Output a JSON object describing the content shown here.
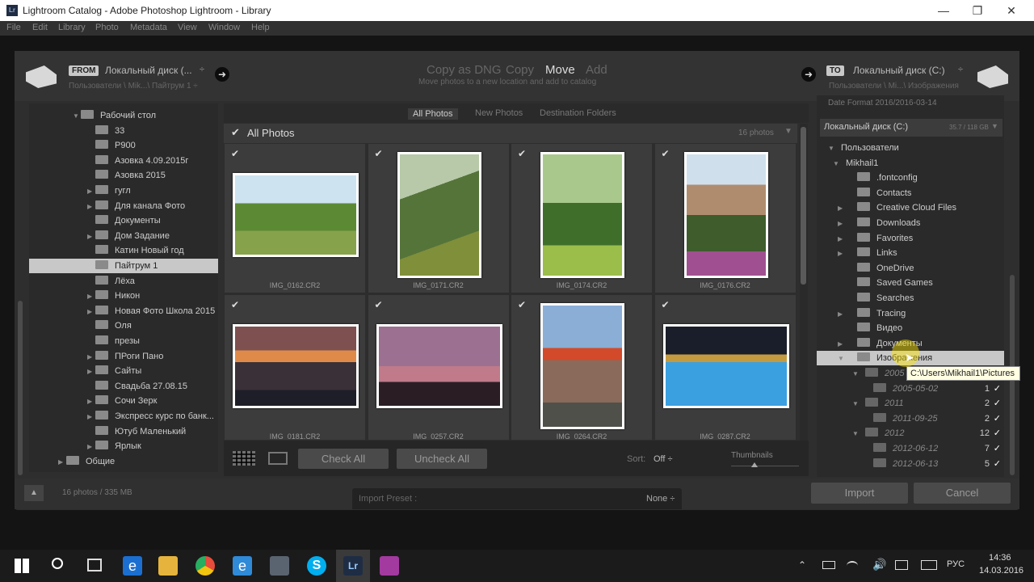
{
  "window": {
    "title": "Lightroom Catalog - Adobe Photoshop Lightroom - Library",
    "app_badge": "Lr",
    "minimize": "—",
    "maximize": "❐",
    "close": "✕"
  },
  "menu": [
    "File",
    "Edit",
    "Library",
    "Photo",
    "Metadata",
    "View",
    "Window",
    "Help"
  ],
  "source": {
    "tag": "FROM",
    "drive": "Локальный диск (...",
    "path": "Пользователи \\ Mik...\\ Пайтрум 1 ÷"
  },
  "modes": {
    "copy_dng": "Copy as DNG",
    "copy": "Copy",
    "move": "Move",
    "add": "Add",
    "subtitle": "Move photos to a new location and add to catalog"
  },
  "dest": {
    "tag": "TO",
    "drive": "Локальный диск (C:)",
    "path": "Пользователи \\ Mi...\\ Изображения"
  },
  "left_tree": [
    {
      "label": "Рабочий стол",
      "indent": 0,
      "arrow": "▼"
    },
    {
      "label": "33",
      "indent": 1,
      "arrow": ""
    },
    {
      "label": "Р900",
      "indent": 1,
      "arrow": ""
    },
    {
      "label": "Азовка 4.09.2015г",
      "indent": 1,
      "arrow": ""
    },
    {
      "label": "Азовка 2015",
      "indent": 1,
      "arrow": ""
    },
    {
      "label": "гугл",
      "indent": 1,
      "arrow": "▶"
    },
    {
      "label": "Для канала Фото",
      "indent": 1,
      "arrow": "▶"
    },
    {
      "label": "Документы",
      "indent": 1,
      "arrow": ""
    },
    {
      "label": "Дом Задание",
      "indent": 1,
      "arrow": "▶"
    },
    {
      "label": "Катин Новый год",
      "indent": 1,
      "arrow": ""
    },
    {
      "label": "Пайтрум 1",
      "indent": 1,
      "arrow": "",
      "selected": true
    },
    {
      "label": "Лёха",
      "indent": 1,
      "arrow": ""
    },
    {
      "label": "Никон",
      "indent": 1,
      "arrow": "▶"
    },
    {
      "label": "Новая Фото Школа 2015",
      "indent": 1,
      "arrow": "▶"
    },
    {
      "label": "Оля",
      "indent": 1,
      "arrow": ""
    },
    {
      "label": "презы",
      "indent": 1,
      "arrow": ""
    },
    {
      "label": "ПРоги Пано",
      "indent": 1,
      "arrow": "▶"
    },
    {
      "label": "Сайты",
      "indent": 1,
      "arrow": "▶"
    },
    {
      "label": "Свадьба 27.08.15",
      "indent": 1,
      "arrow": ""
    },
    {
      "label": "Сочи Зерк",
      "indent": 1,
      "arrow": "▶"
    },
    {
      "label": "Экспресс курс по банк...",
      "indent": 1,
      "arrow": "▶"
    },
    {
      "label": "Ютуб Маленький",
      "indent": 1,
      "arrow": ""
    },
    {
      "label": "Ярлык",
      "indent": 1,
      "arrow": "▶"
    },
    {
      "label": "Общие",
      "indent": -1,
      "arrow": "▶"
    }
  ],
  "filters": {
    "all": "All Photos",
    "new": "New Photos",
    "dest": "Destination Folders"
  },
  "grid_header": {
    "label": "All Photos",
    "count": "16 photos"
  },
  "photos": [
    {
      "name": "IMG_0162.CR2"
    },
    {
      "name": "IMG_0171.CR2"
    },
    {
      "name": "IMG_0174.CR2"
    },
    {
      "name": "IMG_0176.CR2"
    },
    {
      "name": "IMG_0181.CR2"
    },
    {
      "name": "IMG_0257.CR2"
    },
    {
      "name": "IMG_0264.CR2"
    },
    {
      "name": "IMG_0287.CR2"
    }
  ],
  "toolbar": {
    "check_all": "Check All",
    "uncheck_all": "Uncheck All",
    "sort_label": "Sort:",
    "sort_value": "Off ÷",
    "thumbnails": "Thumbnails"
  },
  "right": {
    "date_format": "Date Format   2016/2016-03-14",
    "volume": "Локальный диск (C:)",
    "volume_size": "35.7 / 118 GB",
    "tree": [
      {
        "label": "Пользователи",
        "arrow": "▼",
        "indent": 0
      },
      {
        "label": "Mikhail1",
        "arrow": "▼",
        "indent": 1
      },
      {
        "label": ".fontconfig",
        "arrow": "",
        "indent": 2
      },
      {
        "label": "Contacts",
        "arrow": "",
        "indent": 2
      },
      {
        "label": "Creative Cloud Files",
        "arrow": "▶",
        "indent": 2
      },
      {
        "label": "Downloads",
        "arrow": "▶",
        "indent": 2
      },
      {
        "label": "Favorites",
        "arrow": "▶",
        "indent": 2
      },
      {
        "label": "Links",
        "arrow": "▶",
        "indent": 2
      },
      {
        "label": "OneDrive",
        "arrow": "",
        "indent": 2
      },
      {
        "label": "Saved Games",
        "arrow": "",
        "indent": 2
      },
      {
        "label": "Searches",
        "arrow": "",
        "indent": 2
      },
      {
        "label": "Tracing",
        "arrow": "▶",
        "indent": 2
      },
      {
        "label": "Видео",
        "arrow": "",
        "indent": 2
      },
      {
        "label": "Документы",
        "arrow": "▶",
        "indent": 2
      },
      {
        "label": "Изображения",
        "arrow": "▼",
        "indent": 2,
        "selected": true
      }
    ],
    "subtree": [
      {
        "label": "2005",
        "count": "",
        "check": "",
        "indent": 3
      },
      {
        "label": "2005-05-02",
        "count": "1",
        "check": "✓",
        "indent": 4
      },
      {
        "label": "2011",
        "count": "2",
        "check": "✓",
        "indent": 3
      },
      {
        "label": "2011-09-25",
        "count": "2",
        "check": "✓",
        "indent": 4
      },
      {
        "label": "2012",
        "count": "12",
        "check": "✓",
        "indent": 3
      },
      {
        "label": "2012-06-12",
        "count": "7",
        "check": "✓",
        "indent": 4
      },
      {
        "label": "2012-06-13",
        "count": "5",
        "check": "✓",
        "indent": 4
      }
    ],
    "tooltip": "C:\\Users\\Mikhail1\\Pictures"
  },
  "bottom": {
    "summary": "16 photos / 335 MB",
    "preset_label": "Import Preset :",
    "preset_value": "None ÷",
    "import": "Import",
    "cancel": "Cancel"
  },
  "taskbar": {
    "lang": "РУС",
    "time": "14:36",
    "date": "14.03.2016"
  }
}
